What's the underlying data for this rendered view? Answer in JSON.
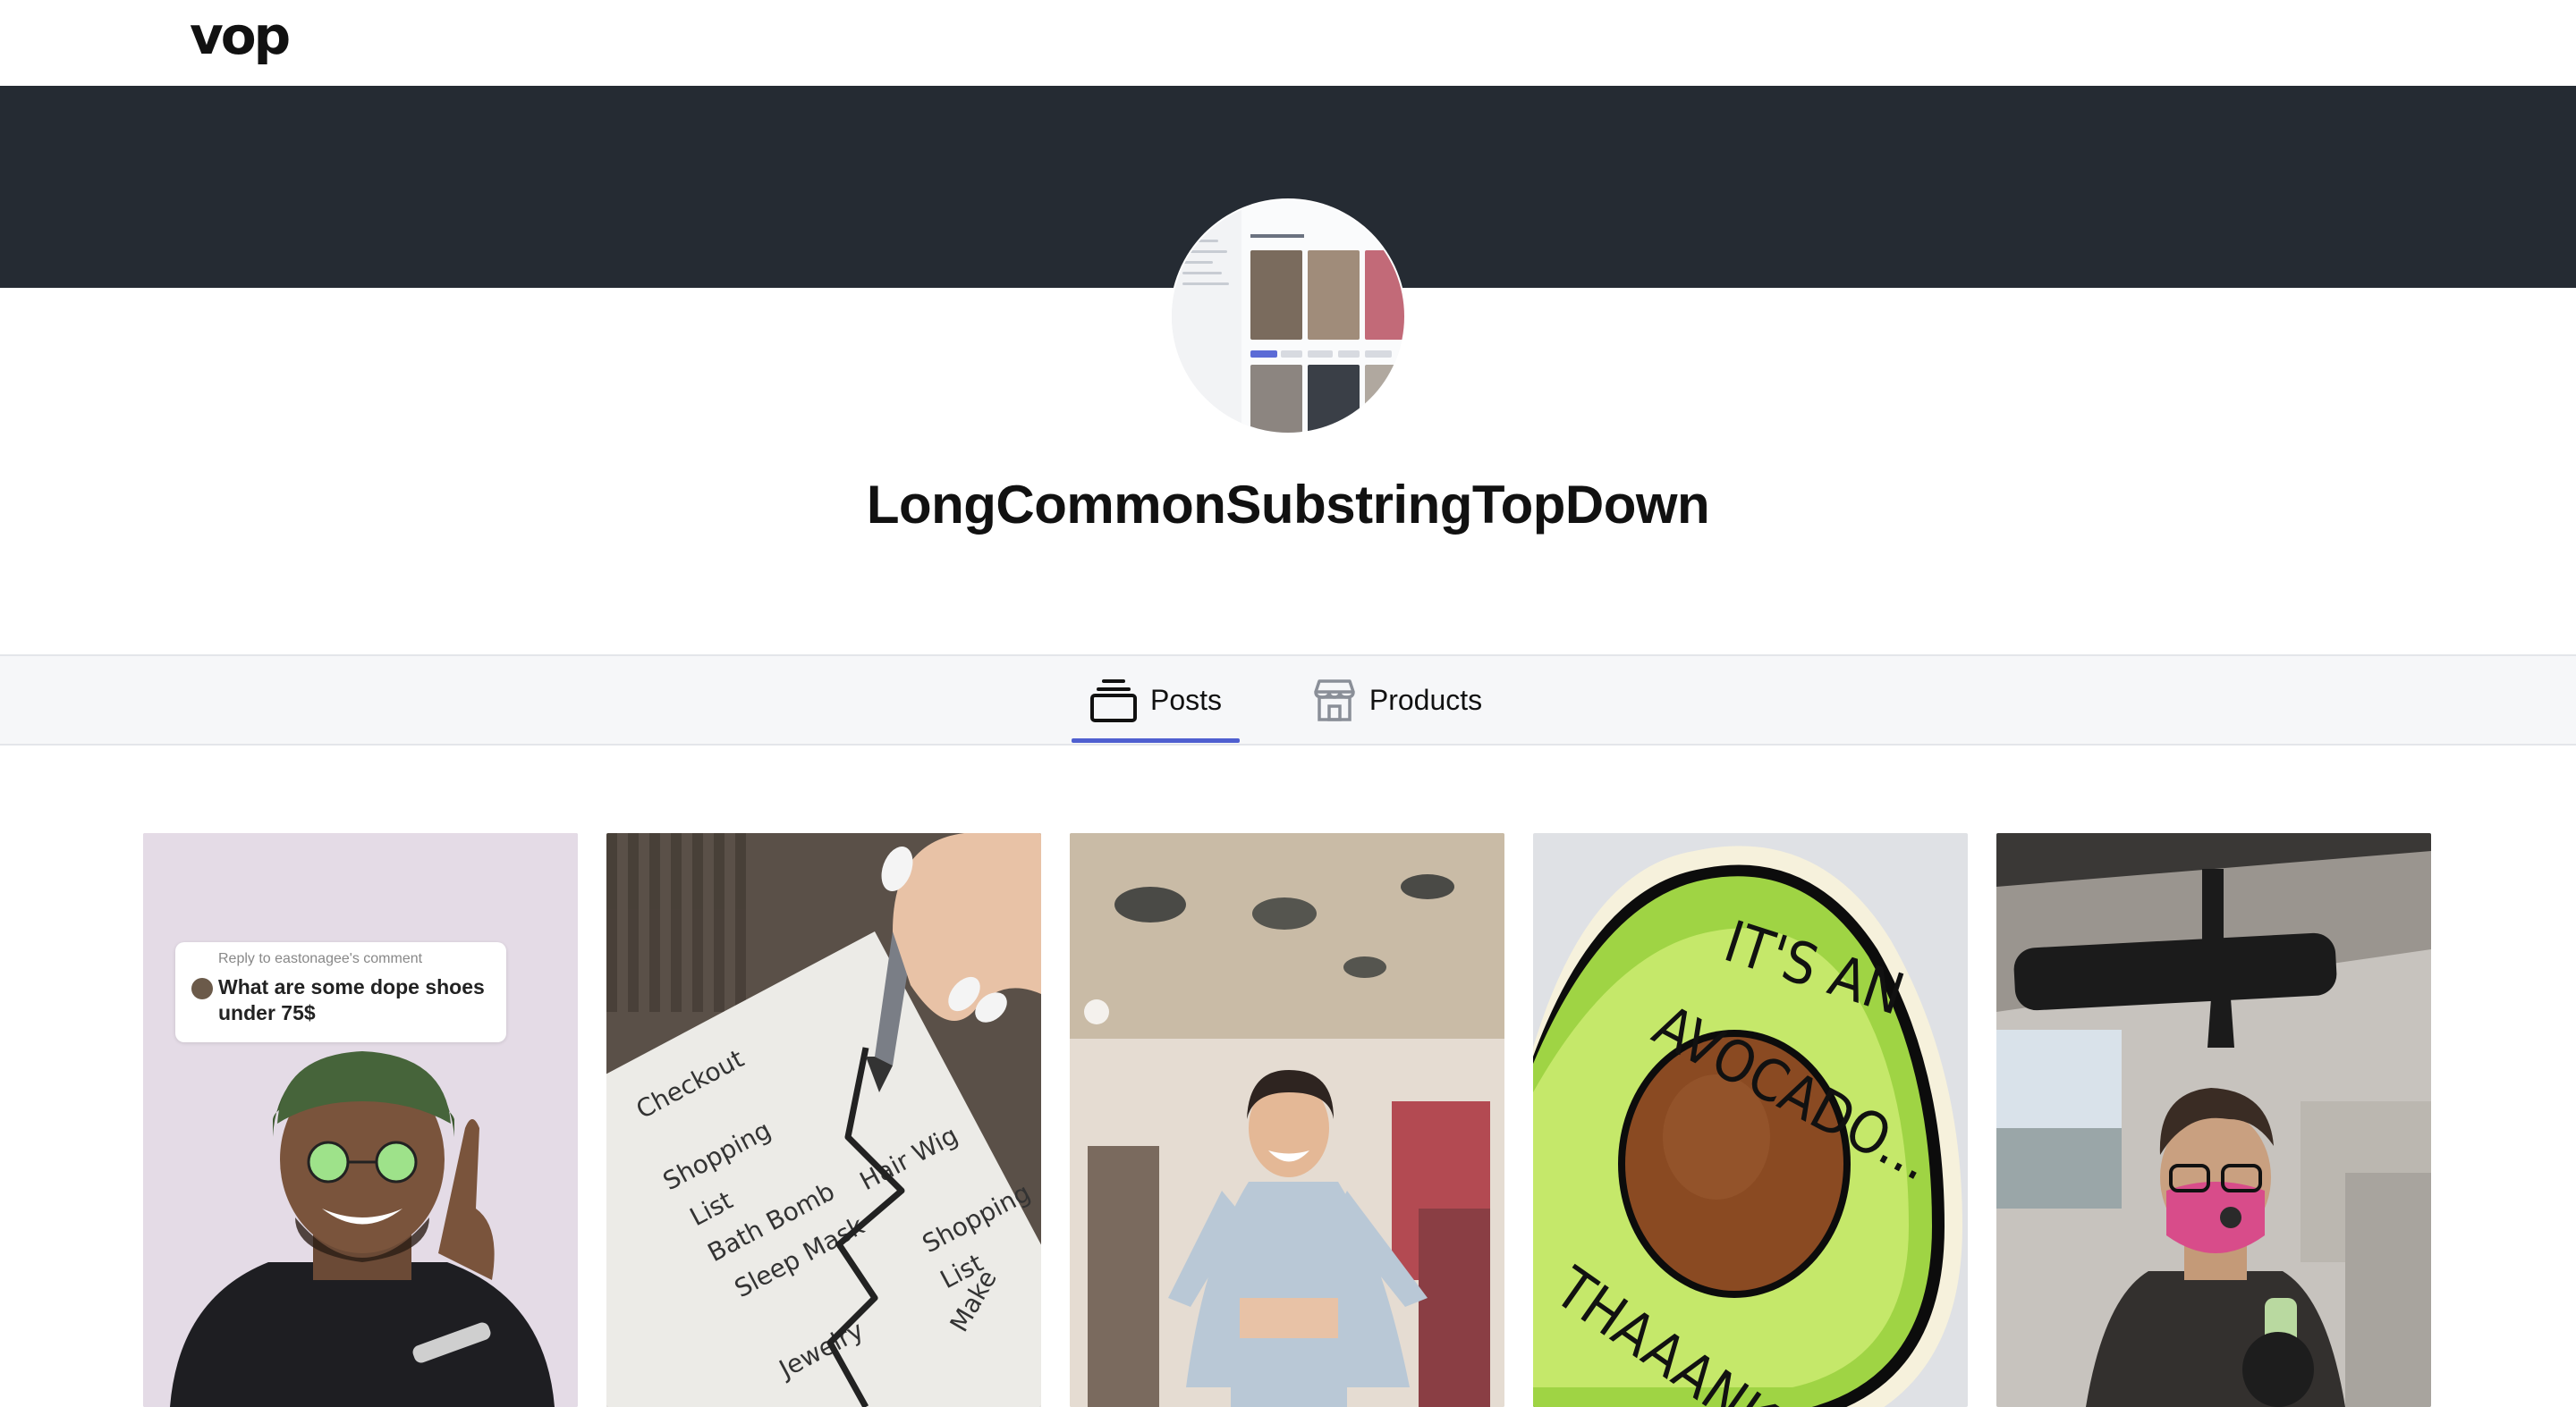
{
  "brand": {
    "logo_text": "vop"
  },
  "profile": {
    "username": "LongCommonSubstringTopDown"
  },
  "tabs": [
    {
      "label": "Posts",
      "icon": "stack-icon",
      "active": true
    },
    {
      "label": "Products",
      "icon": "storefront-icon",
      "active": false
    }
  ],
  "colors": {
    "banner": "#252b33",
    "tab_active": "#4f5fd0",
    "tabbar": "#f6f7f9"
  },
  "posts": [
    {
      "reply_caption": "Reply to eastonagee's comment",
      "reply_question": "What are some dope shoes under 75$"
    },
    {
      "scene": "hand drawing on shopping list"
    },
    {
      "scene": "woman dancing in boutique"
    },
    {
      "scene": "avocado sticker"
    },
    {
      "scene": "woman with mask in car"
    }
  ]
}
